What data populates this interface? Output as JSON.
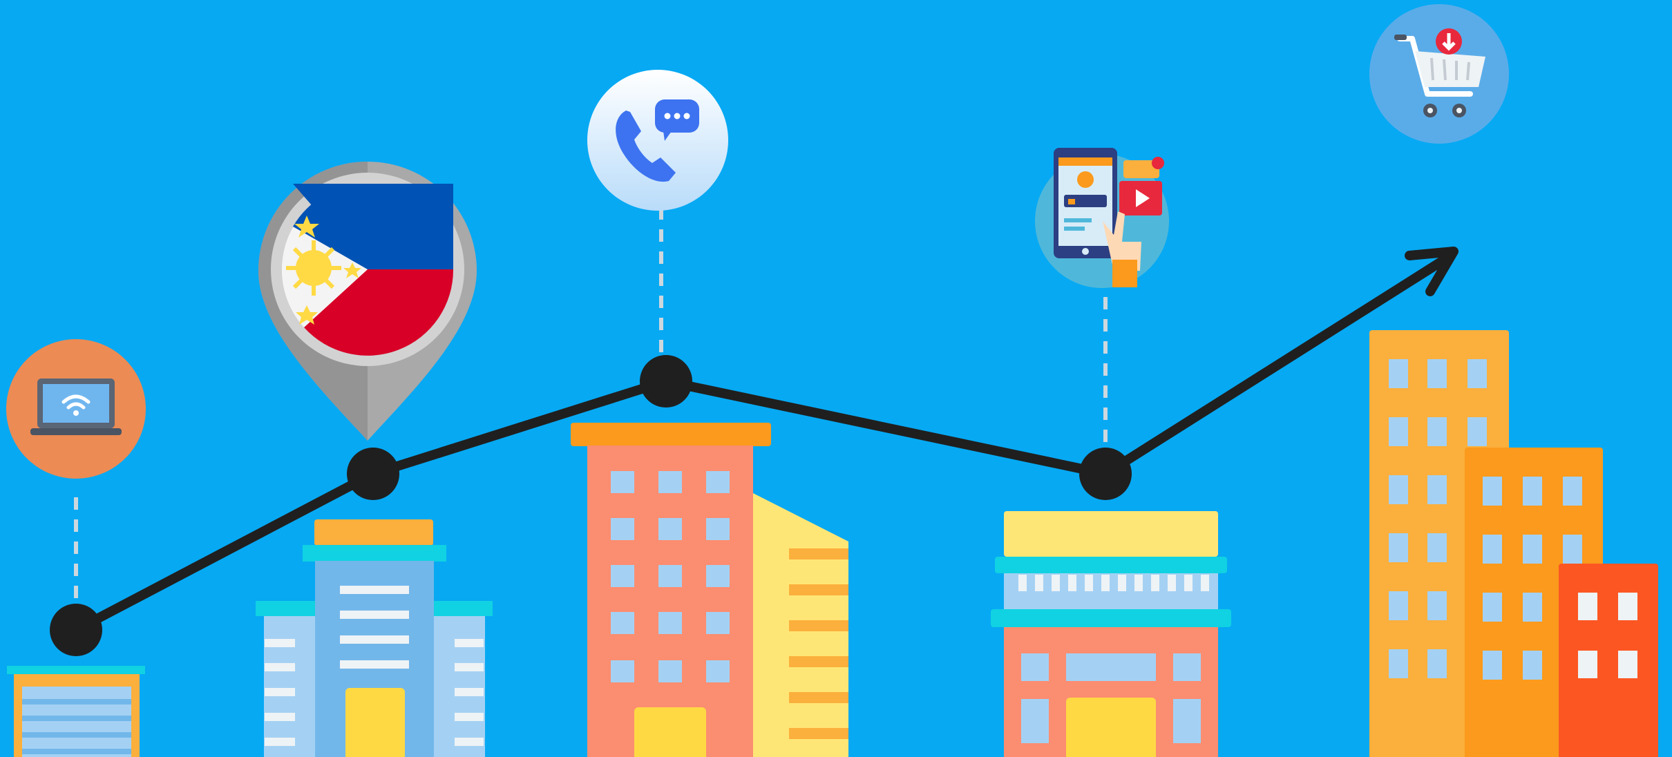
{
  "colors": {
    "background": "#07a9f3",
    "trend_line": "#1f1f1f",
    "node": "#1f1f1f",
    "dashed_connector": "#cdd7de",
    "building_orange": "#fbaf3c",
    "building_dark_orange": "#fb9a1c",
    "building_red": "#fc5622",
    "building_salmon": "#fb8d70",
    "building_light_blue": "#a4d1f3",
    "building_blue": "#72b7ea",
    "building_yellow": "#fee676",
    "cyan_band": "#10d2e2",
    "door_yellow": "#ffd944",
    "window_white": "#eef3f6"
  },
  "icons": [
    "laptop-wifi-icon",
    "philippines-map-pin-icon",
    "phone-chat-icon",
    "mobile-social-media-icon",
    "shopping-cart-download-icon",
    "trend-arrow-icon"
  ]
}
